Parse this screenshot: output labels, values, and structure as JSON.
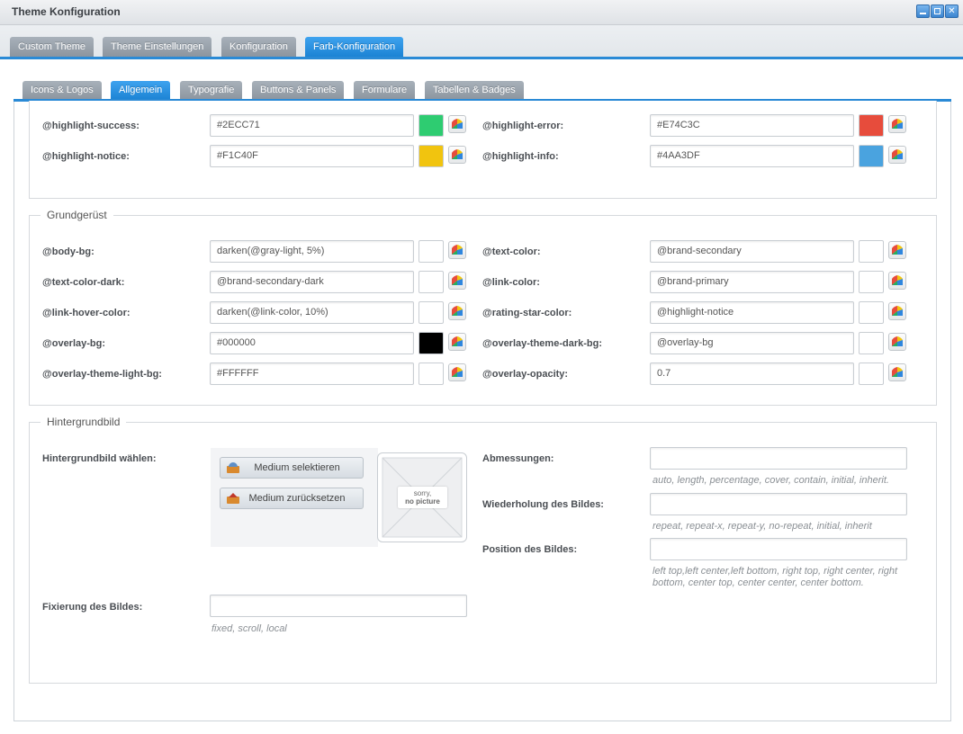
{
  "window": {
    "title": "Theme Konfiguration"
  },
  "main_tabs": [
    "Custom Theme",
    "Theme Einstellungen",
    "Konfiguration",
    "Farb-Konfiguration"
  ],
  "sub_tabs": [
    "Icons & Logos",
    "Allgemein",
    "Typografie",
    "Buttons & Panels",
    "Formulare",
    "Tabellen & Badges"
  ],
  "highlight": {
    "success": {
      "label": "@highlight-success:",
      "value": "#2ECC71",
      "swatch": "#2ECC71"
    },
    "error": {
      "label": "@highlight-error:",
      "value": "#E74C3C",
      "swatch": "#E74C3C"
    },
    "notice": {
      "label": "@highlight-notice:",
      "value": "#F1C40F",
      "swatch": "#F1C40F"
    },
    "info": {
      "label": "@highlight-info:",
      "value": "#4AA3DF",
      "swatch": "#4AA3DF"
    }
  },
  "grundgeruest": {
    "legend": "Grundgerüst",
    "body_bg": {
      "label": "@body-bg:",
      "value": "darken(@gray-light, 5%)"
    },
    "text_color": {
      "label": "@text-color:",
      "value": "@brand-secondary"
    },
    "text_color_dark": {
      "label": "@text-color-dark:",
      "value": "@brand-secondary-dark"
    },
    "link_color": {
      "label": "@link-color:",
      "value": "@brand-primary"
    },
    "link_hover_color": {
      "label": "@link-hover-color:",
      "value": "darken(@link-color, 10%)"
    },
    "rating_star_color": {
      "label": "@rating-star-color:",
      "value": "@highlight-notice"
    },
    "overlay_bg": {
      "label": "@overlay-bg:",
      "value": "#000000",
      "swatch": "#000000"
    },
    "overlay_theme_dark_bg": {
      "label": "@overlay-theme-dark-bg:",
      "value": "@overlay-bg"
    },
    "overlay_theme_light_bg": {
      "label": "@overlay-theme-light-bg:",
      "value": "#FFFFFF",
      "swatch": "#FFFFFF"
    },
    "overlay_opacity": {
      "label": "@overlay-opacity:",
      "value": "0.7"
    }
  },
  "hintergrund": {
    "legend": "Hintergrundbild",
    "choose_label": "Hintergrundbild wählen:",
    "select_button": "Medium selektieren",
    "reset_button": "Medium zurücksetzen",
    "no_picture_line1": "sorry,",
    "no_picture_line2": "no picture",
    "dimensions": {
      "label": "Abmessungen:",
      "value": "",
      "hint": "auto, length, percentage, cover, contain, initial, inherit."
    },
    "repeat": {
      "label": "Wiederholung des Bildes:",
      "value": "",
      "hint": "repeat, repeat-x, repeat-y, no-repeat, initial, inherit"
    },
    "position": {
      "label": "Position des Bildes:",
      "value": "",
      "hint_line1": "left top,left center,left bottom, right top, right center, right",
      "hint_line2": "bottom, center top, center center, center bottom."
    },
    "attachment": {
      "label": "Fixierung des Bildes:",
      "value": "",
      "hint": "fixed, scroll, local"
    }
  },
  "colors": {
    "accent": "#2a8ad6",
    "tab_inactive": "#969fa8"
  }
}
